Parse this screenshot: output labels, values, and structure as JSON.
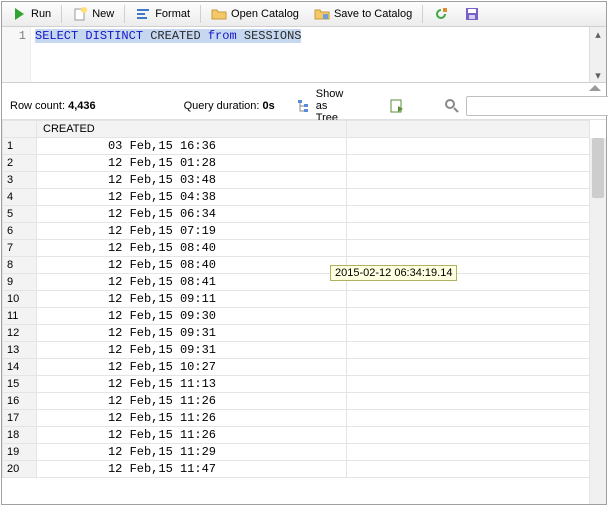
{
  "toolbar": {
    "run": "Run",
    "new": "New",
    "format": "Format",
    "open_catalog": "Open Catalog",
    "save_catalog": "Save to Catalog"
  },
  "editor": {
    "line_no": "1",
    "kw_select": "SELECT",
    "kw_distinct": "DISTINCT",
    "ident_created": "CREATED",
    "kw_from": "from",
    "ident_sessions": "SESSIONS"
  },
  "status": {
    "row_count_label": "Row count:",
    "row_count_value": "4,436",
    "duration_label": "Query duration:",
    "duration_value": "0s",
    "show_as_tree": "Show as Tree",
    "search_placeholder": ""
  },
  "grid": {
    "header": "CREATED",
    "rows": [
      {
        "n": "1",
        "v": "03 Feb,15 16:36"
      },
      {
        "n": "2",
        "v": "12 Feb,15 01:28"
      },
      {
        "n": "3",
        "v": "12 Feb,15 03:48"
      },
      {
        "n": "4",
        "v": "12 Feb,15 04:38"
      },
      {
        "n": "5",
        "v": "12 Feb,15 06:34"
      },
      {
        "n": "6",
        "v": "12 Feb,15 07:19"
      },
      {
        "n": "7",
        "v": "12 Feb,15 08:40"
      },
      {
        "n": "8",
        "v": "12 Feb,15 08:40"
      },
      {
        "n": "9",
        "v": "12 Feb,15 08:41"
      },
      {
        "n": "10",
        "v": "12 Feb,15 09:11"
      },
      {
        "n": "11",
        "v": "12 Feb,15 09:30"
      },
      {
        "n": "12",
        "v": "12 Feb,15 09:31"
      },
      {
        "n": "13",
        "v": "12 Feb,15 09:31"
      },
      {
        "n": "14",
        "v": "12 Feb,15 10:27"
      },
      {
        "n": "15",
        "v": "12 Feb,15 11:13"
      },
      {
        "n": "16",
        "v": "12 Feb,15 11:26"
      },
      {
        "n": "17",
        "v": "12 Feb,15 11:26"
      },
      {
        "n": "18",
        "v": "12 Feb,15 11:26"
      },
      {
        "n": "19",
        "v": "12 Feb,15 11:29"
      },
      {
        "n": "20",
        "v": "12 Feb,15 11:47"
      }
    ]
  },
  "tooltip": "2015-02-12 06:34:19.14"
}
